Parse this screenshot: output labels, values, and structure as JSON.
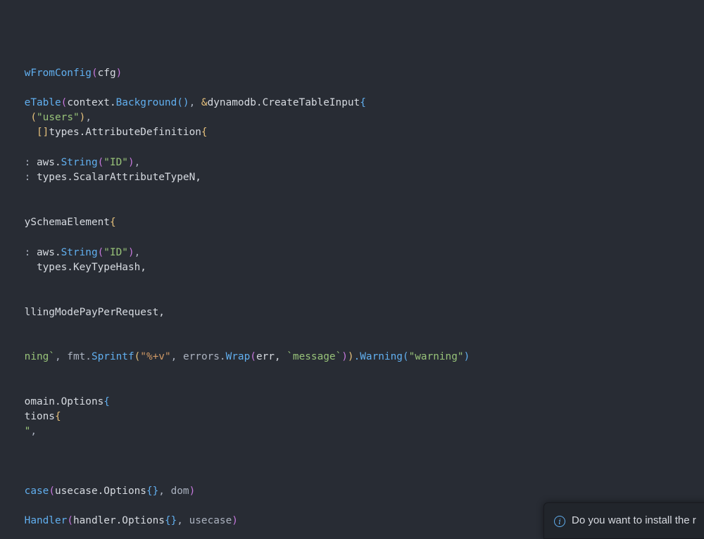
{
  "editor": {
    "lines": [
      "wFromConfig(cfg)",
      "eTable(context.Background(), &dynamodb.CreateTableInput{",
      " (\"users\"),",
      "  []types.AttributeDefinition{",
      ": aws.String(\"ID\"),",
      ": types.ScalarAttributeTypeN,",
      "ySchemaElement{",
      ": aws.String(\"ID\"),",
      "  types.KeyTypeHash,",
      "llingModePayPerRequest,",
      "ning`, fmt.Sprintf(\"%+v\", errors.Wrap(err, `message`)).Warning(\"warning\")",
      "omain.Options{",
      "tions{",
      "\",",
      "case(usecase.Options{}, dom)",
      "Handler(handler.Options{}, usecase)"
    ]
  },
  "notification": {
    "icon": "info-icon",
    "text": "Do you want to install the r"
  },
  "colors": {
    "background": "#282c34",
    "function": "#61afef",
    "string": "#98c379",
    "brace": "#e5c07b",
    "keyword": "#c678dd",
    "text": "#abb2bf"
  }
}
